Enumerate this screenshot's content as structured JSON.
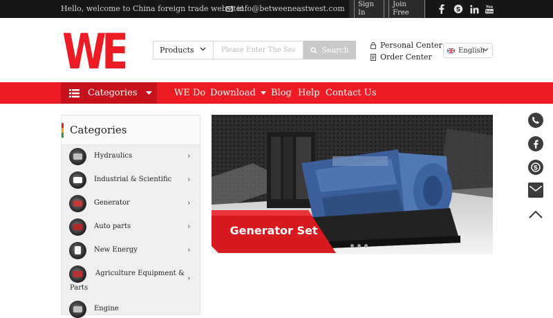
{
  "topbar": {
    "welcome": "Hello, welcome to China foreign trade website!",
    "email": "info@betweeneastwest.com",
    "sign_in": "Sign In",
    "join_free": "Join Free",
    "social_icons": [
      "facebook-icon",
      "skype-icon",
      "linkedin-icon",
      "youtube-icon"
    ]
  },
  "header": {
    "logo_text": "WE",
    "search": {
      "category": "Products",
      "placeholder": "Please Enter The Search",
      "button": "Search"
    },
    "personal_center": "Personal Center",
    "order_center": "Order Center",
    "language": "English"
  },
  "nav": {
    "categories": "Categories",
    "items": [
      "WE Do",
      "Download",
      "Blog",
      "Help",
      "Contact Us"
    ]
  },
  "sidebar": {
    "title": "Categories",
    "items": [
      {
        "label": "Hydraulics"
      },
      {
        "label": "Industrial & Scientific"
      },
      {
        "label": "Generator"
      },
      {
        "label": "Auto parts"
      },
      {
        "label": "New Energy"
      },
      {
        "label": "Agriculture Equipment &",
        "label2": "Parts"
      },
      {
        "label": "Engine"
      }
    ]
  },
  "banner": {
    "caption": "Generator Set",
    "slides": 3
  },
  "floating_icons": [
    "phone-icon",
    "facebook-icon",
    "skype-icon",
    "mail-icon",
    "chevron-up-icon"
  ],
  "colors": {
    "brand_red": "#ed1c24",
    "dark_red": "#c8121b",
    "topbar": "#171717",
    "engine_blue": "#3a5f9a"
  }
}
